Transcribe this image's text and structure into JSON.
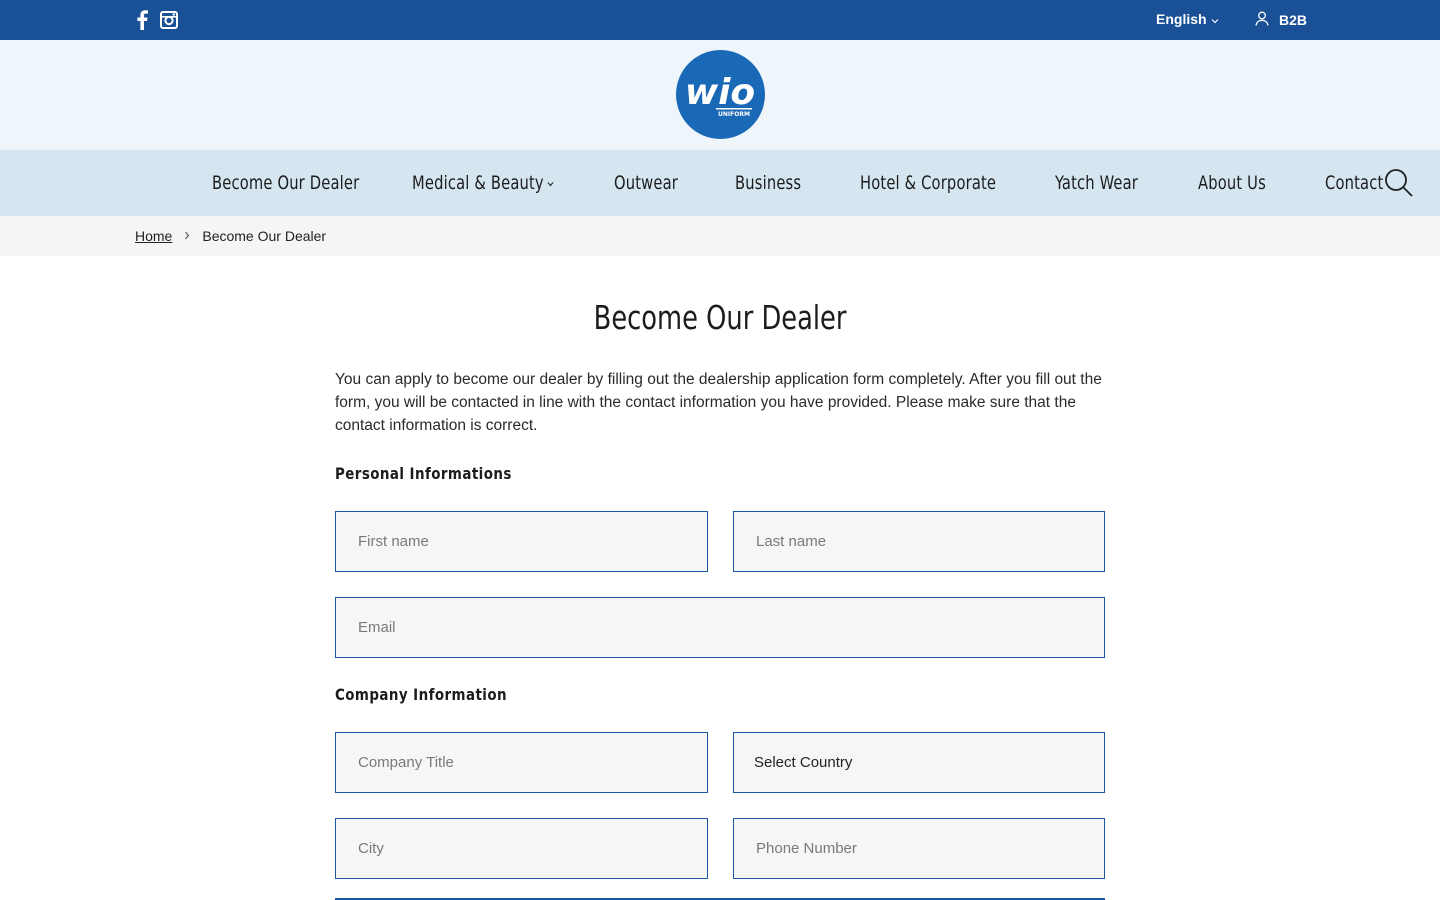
{
  "topbar": {
    "language": "English",
    "b2b_label": "B2B"
  },
  "logo": {
    "text": "wio",
    "subtext": "UNIFORM"
  },
  "nav": {
    "items": [
      "Become Our Dealer",
      "Medical & Beauty",
      "Outwear",
      "Business",
      "Hotel & Corporate",
      "Yatch Wear",
      "About Us",
      "Contact"
    ]
  },
  "breadcrumb": {
    "home": "Home",
    "current": "Become Our Dealer"
  },
  "main": {
    "title": "Become Our Dealer",
    "intro": "You can apply to become our dealer by filling out the dealership application form completely. After you fill out the form, you will be contacted in line with the contact information you have provided. Please make sure that the contact information is correct.",
    "personal_heading": "Personal Informations",
    "company_heading": "Company Information",
    "fields": {
      "first_name": "First name",
      "last_name": "Last name",
      "email": "Email",
      "company_title": "Company Title",
      "country": "Select Country",
      "city": "City",
      "phone": "Phone Number"
    }
  },
  "colors": {
    "topbar": "#1a5096",
    "logo_strip": "#eff6fb",
    "nav": "#d5e6f1",
    "breadcrumb": "#f5f5f5",
    "field_border": "#1c57a5",
    "logo_circle": "#1a69b7"
  }
}
